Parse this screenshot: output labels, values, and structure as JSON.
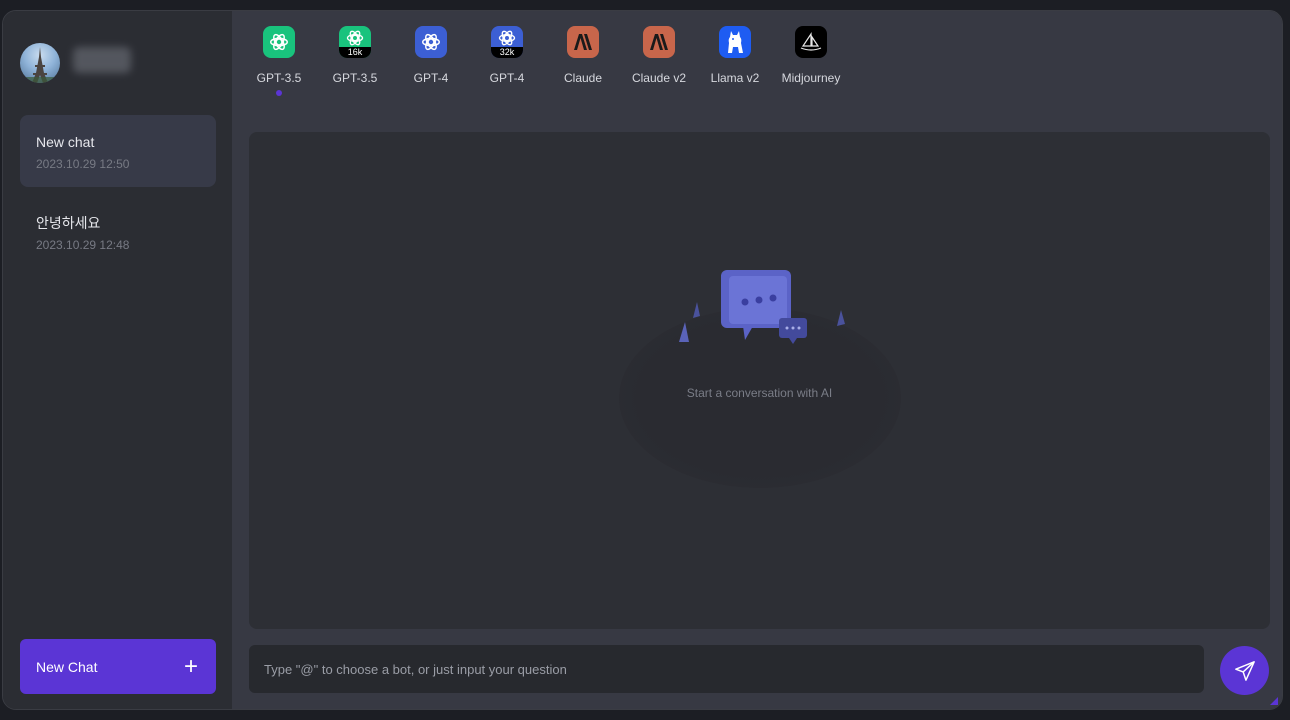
{
  "user": {
    "avatar_icon": "eiffel-tower-icon"
  },
  "chats": [
    {
      "title": "New chat",
      "time": "2023.10.29 12:50",
      "active": true
    },
    {
      "title": "안녕하세요",
      "time": "2023.10.29 12:48",
      "active": false
    }
  ],
  "new_chat_button": {
    "label": "New Chat",
    "icon": "plus-icon"
  },
  "bots": [
    {
      "label": "GPT-3.5",
      "badge": "",
      "icon": "openai-icon",
      "color": "#19c37d",
      "selected": true
    },
    {
      "label": "GPT-3.5",
      "badge": "16k",
      "icon": "openai-icon",
      "color": "#19c37d",
      "selected": false
    },
    {
      "label": "GPT-4",
      "badge": "",
      "icon": "openai-icon",
      "color": "#3c5fd4",
      "selected": false
    },
    {
      "label": "GPT-4",
      "badge": "32k",
      "icon": "openai-icon",
      "color": "#3c5fd4",
      "selected": false
    },
    {
      "label": "Claude",
      "badge": "",
      "icon": "anthropic-icon",
      "color": "#c8664b",
      "selected": false
    },
    {
      "label": "Claude v2",
      "badge": "",
      "icon": "anthropic-icon",
      "color": "#c8664b",
      "selected": false
    },
    {
      "label": "Llama v2",
      "badge": "",
      "icon": "llama-icon",
      "color": "#1e5cf2",
      "selected": false
    },
    {
      "label": "Midjourney",
      "badge": "",
      "icon": "midjourney-icon",
      "color": "#000000",
      "selected": false
    }
  ],
  "empty_state": {
    "text": "Start a conversation with AI",
    "icon": "chat-bubbles-icon"
  },
  "input": {
    "placeholder": "Type \"@\" to choose a bot, or just input your question",
    "value": ""
  },
  "send_button": {
    "icon": "paper-plane-icon"
  },
  "colors": {
    "accent": "#5b35d5",
    "sidebar_bg": "#2b2d33",
    "main_bg": "#373943"
  }
}
